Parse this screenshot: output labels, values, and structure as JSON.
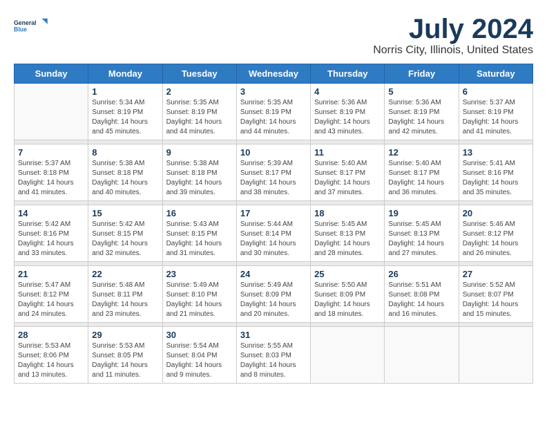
{
  "logo": {
    "line1": "General",
    "line2": "Blue"
  },
  "title": "July 2024",
  "subtitle": "Norris City, Illinois, United States",
  "weekdays": [
    "Sunday",
    "Monday",
    "Tuesday",
    "Wednesday",
    "Thursday",
    "Friday",
    "Saturday"
  ],
  "weeks": [
    [
      {
        "day": "",
        "info": ""
      },
      {
        "day": "1",
        "info": "Sunrise: 5:34 AM\nSunset: 8:19 PM\nDaylight: 14 hours\nand 45 minutes."
      },
      {
        "day": "2",
        "info": "Sunrise: 5:35 AM\nSunset: 8:19 PM\nDaylight: 14 hours\nand 44 minutes."
      },
      {
        "day": "3",
        "info": "Sunrise: 5:35 AM\nSunset: 8:19 PM\nDaylight: 14 hours\nand 44 minutes."
      },
      {
        "day": "4",
        "info": "Sunrise: 5:36 AM\nSunset: 8:19 PM\nDaylight: 14 hours\nand 43 minutes."
      },
      {
        "day": "5",
        "info": "Sunrise: 5:36 AM\nSunset: 8:19 PM\nDaylight: 14 hours\nand 42 minutes."
      },
      {
        "day": "6",
        "info": "Sunrise: 5:37 AM\nSunset: 8:19 PM\nDaylight: 14 hours\nand 41 minutes."
      }
    ],
    [
      {
        "day": "7",
        "info": "Sunrise: 5:37 AM\nSunset: 8:18 PM\nDaylight: 14 hours\nand 41 minutes."
      },
      {
        "day": "8",
        "info": "Sunrise: 5:38 AM\nSunset: 8:18 PM\nDaylight: 14 hours\nand 40 minutes."
      },
      {
        "day": "9",
        "info": "Sunrise: 5:38 AM\nSunset: 8:18 PM\nDaylight: 14 hours\nand 39 minutes."
      },
      {
        "day": "10",
        "info": "Sunrise: 5:39 AM\nSunset: 8:17 PM\nDaylight: 14 hours\nand 38 minutes."
      },
      {
        "day": "11",
        "info": "Sunrise: 5:40 AM\nSunset: 8:17 PM\nDaylight: 14 hours\nand 37 minutes."
      },
      {
        "day": "12",
        "info": "Sunrise: 5:40 AM\nSunset: 8:17 PM\nDaylight: 14 hours\nand 36 minutes."
      },
      {
        "day": "13",
        "info": "Sunrise: 5:41 AM\nSunset: 8:16 PM\nDaylight: 14 hours\nand 35 minutes."
      }
    ],
    [
      {
        "day": "14",
        "info": "Sunrise: 5:42 AM\nSunset: 8:16 PM\nDaylight: 14 hours\nand 33 minutes."
      },
      {
        "day": "15",
        "info": "Sunrise: 5:42 AM\nSunset: 8:15 PM\nDaylight: 14 hours\nand 32 minutes."
      },
      {
        "day": "16",
        "info": "Sunrise: 5:43 AM\nSunset: 8:15 PM\nDaylight: 14 hours\nand 31 minutes."
      },
      {
        "day": "17",
        "info": "Sunrise: 5:44 AM\nSunset: 8:14 PM\nDaylight: 14 hours\nand 30 minutes."
      },
      {
        "day": "18",
        "info": "Sunrise: 5:45 AM\nSunset: 8:13 PM\nDaylight: 14 hours\nand 28 minutes."
      },
      {
        "day": "19",
        "info": "Sunrise: 5:45 AM\nSunset: 8:13 PM\nDaylight: 14 hours\nand 27 minutes."
      },
      {
        "day": "20",
        "info": "Sunrise: 5:46 AM\nSunset: 8:12 PM\nDaylight: 14 hours\nand 26 minutes."
      }
    ],
    [
      {
        "day": "21",
        "info": "Sunrise: 5:47 AM\nSunset: 8:12 PM\nDaylight: 14 hours\nand 24 minutes."
      },
      {
        "day": "22",
        "info": "Sunrise: 5:48 AM\nSunset: 8:11 PM\nDaylight: 14 hours\nand 23 minutes."
      },
      {
        "day": "23",
        "info": "Sunrise: 5:49 AM\nSunset: 8:10 PM\nDaylight: 14 hours\nand 21 minutes."
      },
      {
        "day": "24",
        "info": "Sunrise: 5:49 AM\nSunset: 8:09 PM\nDaylight: 14 hours\nand 20 minutes."
      },
      {
        "day": "25",
        "info": "Sunrise: 5:50 AM\nSunset: 8:09 PM\nDaylight: 14 hours\nand 18 minutes."
      },
      {
        "day": "26",
        "info": "Sunrise: 5:51 AM\nSunset: 8:08 PM\nDaylight: 14 hours\nand 16 minutes."
      },
      {
        "day": "27",
        "info": "Sunrise: 5:52 AM\nSunset: 8:07 PM\nDaylight: 14 hours\nand 15 minutes."
      }
    ],
    [
      {
        "day": "28",
        "info": "Sunrise: 5:53 AM\nSunset: 8:06 PM\nDaylight: 14 hours\nand 13 minutes."
      },
      {
        "day": "29",
        "info": "Sunrise: 5:53 AM\nSunset: 8:05 PM\nDaylight: 14 hours\nand 11 minutes."
      },
      {
        "day": "30",
        "info": "Sunrise: 5:54 AM\nSunset: 8:04 PM\nDaylight: 14 hours\nand 9 minutes."
      },
      {
        "day": "31",
        "info": "Sunrise: 5:55 AM\nSunset: 8:03 PM\nDaylight: 14 hours\nand 8 minutes."
      },
      {
        "day": "",
        "info": ""
      },
      {
        "day": "",
        "info": ""
      },
      {
        "day": "",
        "info": ""
      }
    ]
  ]
}
